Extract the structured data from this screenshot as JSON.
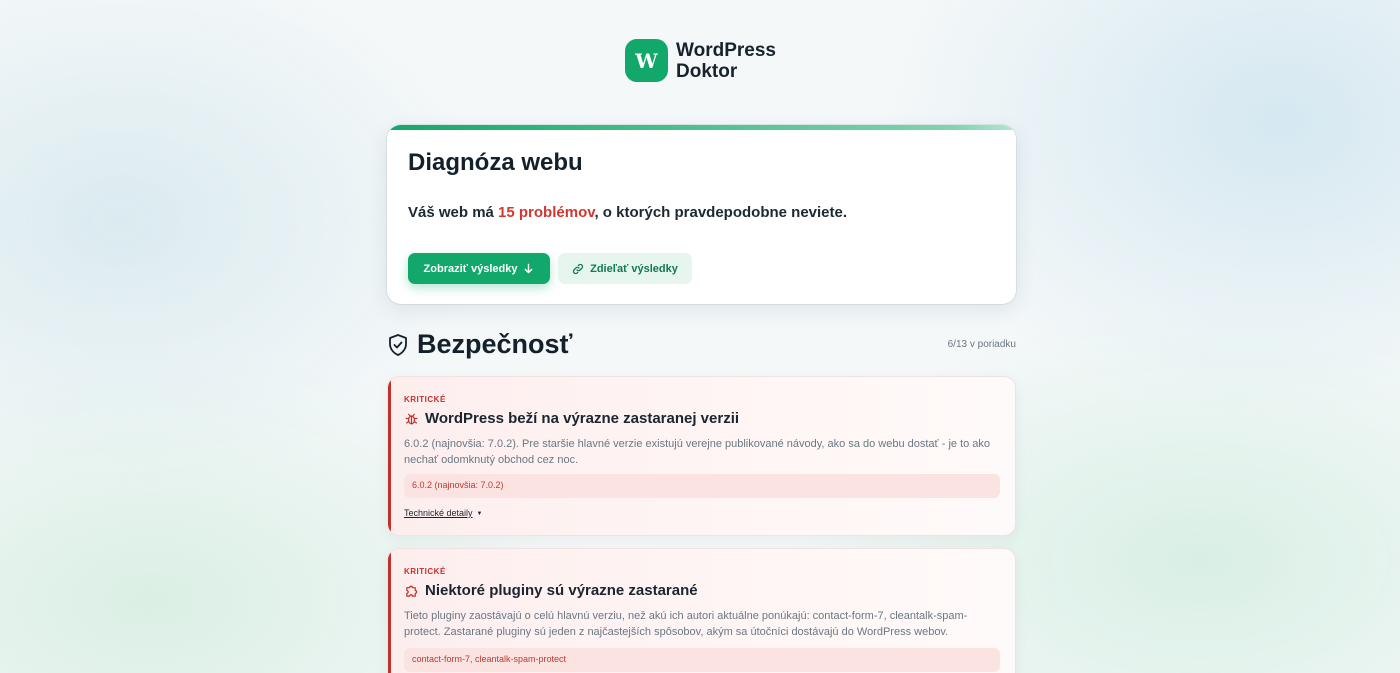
{
  "brand": {
    "mark": "W",
    "name_line1": "WordPress",
    "name_line2": "Doktor",
    "color": "#12a86b"
  },
  "hero": {
    "title": "Diagnóza webu",
    "message_prefix": "Váš web má ",
    "message_highlight": "15 problémov",
    "message_suffix": ", o ktorých pravdepodobne neviete.",
    "primary_button": "Zobraziť výsledky",
    "primary_button_icon": "arrow-down-icon",
    "secondary_button": "Zdieľať výsledky",
    "secondary_button_icon": "link-icon"
  },
  "section": {
    "icon": "shield-check-icon",
    "title": "Bezpečnosť",
    "count": "6/13 v poriadku"
  },
  "issues": [
    {
      "severity": "KRITICKÉ",
      "icon": "bug-icon",
      "title": "WordPress beží na výrazne zastaranej verzii",
      "description": "6.0.2 (najnovšia: 7.0.2). Pre staršie hlavné verzie existujú verejne publikované návody, ako sa do webu dostať - je to ako nechať odomknutý obchod cez noc.",
      "detail": "6.0.2 (najnovšia: 7.0.2)",
      "tech_link": "Technické detaily",
      "tech_caret": "▼"
    },
    {
      "severity": "KRITICKÉ",
      "icon": "puzzle-icon",
      "title": "Niektoré pluginy sú výrazne zastarané",
      "description": "Tieto pluginy zaostávajú o celú hlavnú verziu, než akú ich autori aktuálne ponúkajú: contact-form-7, cleantalk-spam-protect. Zastarané pluginy sú jeden z najčastejších spôsobov, akým sa útočníci dostávajú do WordPress webov.",
      "detail": "contact-form-7, cleantalk-spam-protect"
    }
  ],
  "colors": {
    "accent": "#12a86b",
    "critical": "#c0312b",
    "highlight": "#d2382f"
  }
}
